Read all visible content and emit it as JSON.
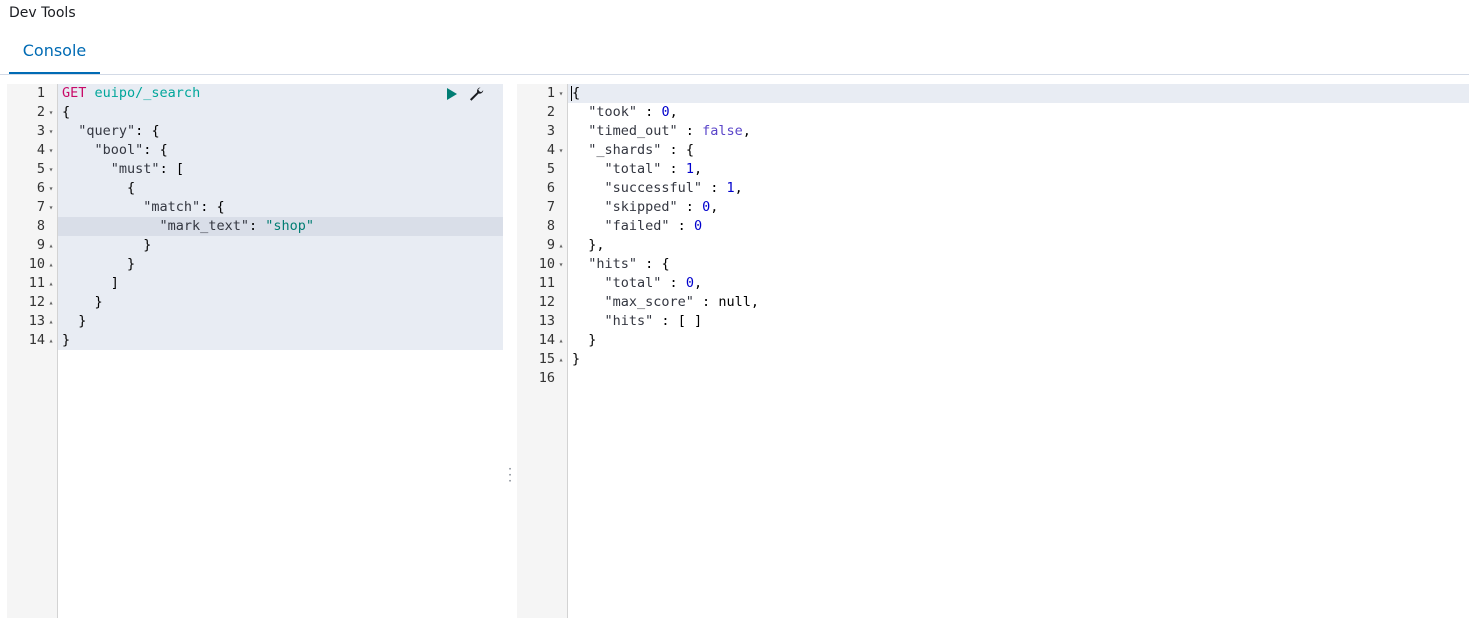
{
  "app": {
    "title": "Dev Tools"
  },
  "tabs": [
    {
      "label": "Console"
    }
  ],
  "request": {
    "method": "GET",
    "path": "euipo/_search",
    "lines": [
      {
        "n": "1",
        "fold": "",
        "text": ""
      },
      {
        "n": "2",
        "fold": "▾",
        "text": "{"
      },
      {
        "n": "3",
        "fold": "▾",
        "text": "  \"query\": {"
      },
      {
        "n": "4",
        "fold": "▾",
        "text": "    \"bool\": {"
      },
      {
        "n": "5",
        "fold": "▾",
        "text": "      \"must\": ["
      },
      {
        "n": "6",
        "fold": "▾",
        "text": "        {"
      },
      {
        "n": "7",
        "fold": "▾",
        "text": "          \"match\": {"
      },
      {
        "n": "8",
        "fold": "",
        "text": "            \"mark_text\": \"shop\""
      },
      {
        "n": "9",
        "fold": "▴",
        "text": "          }"
      },
      {
        "n": "10",
        "fold": "▴",
        "text": "        }"
      },
      {
        "n": "11",
        "fold": "▴",
        "text": "      ]"
      },
      {
        "n": "12",
        "fold": "▴",
        "text": "    }"
      },
      {
        "n": "13",
        "fold": "▴",
        "text": "  }"
      },
      {
        "n": "14",
        "fold": "▴",
        "text": "}"
      }
    ]
  },
  "response": {
    "lines": [
      {
        "n": "1",
        "fold": "▾",
        "text": "{"
      },
      {
        "n": "2",
        "fold": "",
        "text": "  \"took\" : 0,"
      },
      {
        "n": "3",
        "fold": "",
        "text": "  \"timed_out\" : false,"
      },
      {
        "n": "4",
        "fold": "▾",
        "text": "  \"_shards\" : {"
      },
      {
        "n": "5",
        "fold": "",
        "text": "    \"total\" : 1,"
      },
      {
        "n": "6",
        "fold": "",
        "text": "    \"successful\" : 1,"
      },
      {
        "n": "7",
        "fold": "",
        "text": "    \"skipped\" : 0,"
      },
      {
        "n": "8",
        "fold": "",
        "text": "    \"failed\" : 0"
      },
      {
        "n": "9",
        "fold": "▴",
        "text": "  },"
      },
      {
        "n": "10",
        "fold": "▾",
        "text": "  \"hits\" : {"
      },
      {
        "n": "11",
        "fold": "",
        "text": "    \"total\" : 0,"
      },
      {
        "n": "12",
        "fold": "",
        "text": "    \"max_score\" : null,"
      },
      {
        "n": "13",
        "fold": "",
        "text": "    \"hits\" : [ ]"
      },
      {
        "n": "14",
        "fold": "▴",
        "text": "  }"
      },
      {
        "n": "15",
        "fold": "▴",
        "text": "}"
      },
      {
        "n": "16",
        "fold": "",
        "text": ""
      }
    ]
  },
  "icons": {
    "run": "play-icon",
    "settings": "wrench-icon",
    "resize": "vertical-dots-icon"
  },
  "colors": {
    "accent": "#006bb4",
    "run": "#017d73",
    "method": "#c80a68",
    "url": "#00a69b",
    "number": "#0000cd",
    "boolean": "#5a45c9"
  }
}
